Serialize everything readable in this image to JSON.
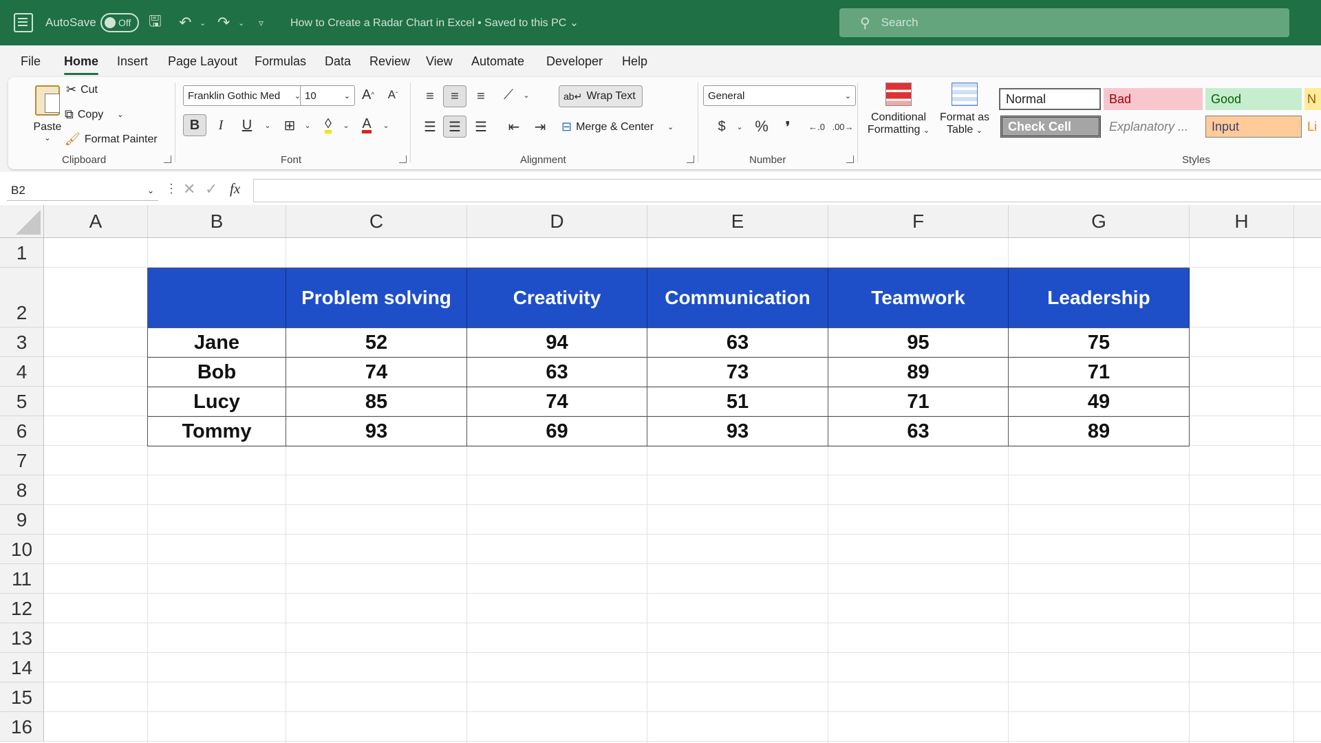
{
  "titlebar": {
    "autosave_label": "AutoSave",
    "toggle_state": "Off",
    "doc_title": "How to Create a Radar Chart in Excel • Saved to this PC ⌄",
    "search_placeholder": "Search"
  },
  "menu": [
    "File",
    "Home",
    "Insert",
    "Page Layout",
    "Formulas",
    "Data",
    "Review",
    "View",
    "Automate",
    "Developer",
    "Help"
  ],
  "ribbon": {
    "clipboard": {
      "paste": "Paste",
      "cut": "Cut",
      "copy": "Copy",
      "format_painter": "Format Painter",
      "group": "Clipboard"
    },
    "font": {
      "family": "Franklin Gothic Med",
      "size": "10",
      "bold": "B",
      "italic": "I",
      "underline": "U",
      "group": "Font"
    },
    "alignment": {
      "wrap": "Wrap Text",
      "merge": "Merge & Center",
      "group": "Alignment"
    },
    "number": {
      "format": "General",
      "currency": "$",
      "percent": "%",
      "comma": "❜",
      "group": "Number"
    },
    "styles": {
      "conditional_1": "Conditional",
      "conditional_2": "Formatting",
      "format_table_1": "Format as",
      "format_table_2": "Table",
      "normal": "Normal",
      "bad": "Bad",
      "good": "Good",
      "neutral": "N",
      "check": "Check Cell",
      "explanatory": "Explanatory ...",
      "input": "Input",
      "linked": "Li",
      "group": "Styles"
    }
  },
  "formula_bar": {
    "name_box": "B2",
    "fx": "fx",
    "value": ""
  },
  "columns": [
    "A",
    "B",
    "C",
    "D",
    "E",
    "F",
    "G",
    "H"
  ],
  "rows": [
    "1",
    "2",
    "3",
    "4",
    "5",
    "6",
    "7",
    "8",
    "9",
    "10",
    "11",
    "12",
    "13",
    "14",
    "15",
    "16"
  ],
  "table": {
    "header": [
      "",
      "Problem solving",
      "Creativity",
      "Communication",
      "Teamwork",
      "Leadership"
    ],
    "rows": [
      [
        "Jane",
        "52",
        "94",
        "63",
        "95",
        "75"
      ],
      [
        "Bob",
        "74",
        "63",
        "73",
        "89",
        "71"
      ],
      [
        "Lucy",
        "85",
        "74",
        "51",
        "71",
        "49"
      ],
      [
        "Tommy",
        "93",
        "69",
        "93",
        "63",
        "89"
      ]
    ]
  },
  "colors": {
    "title_green": "#1f7044",
    "header_blue": "#1f4fc8"
  }
}
